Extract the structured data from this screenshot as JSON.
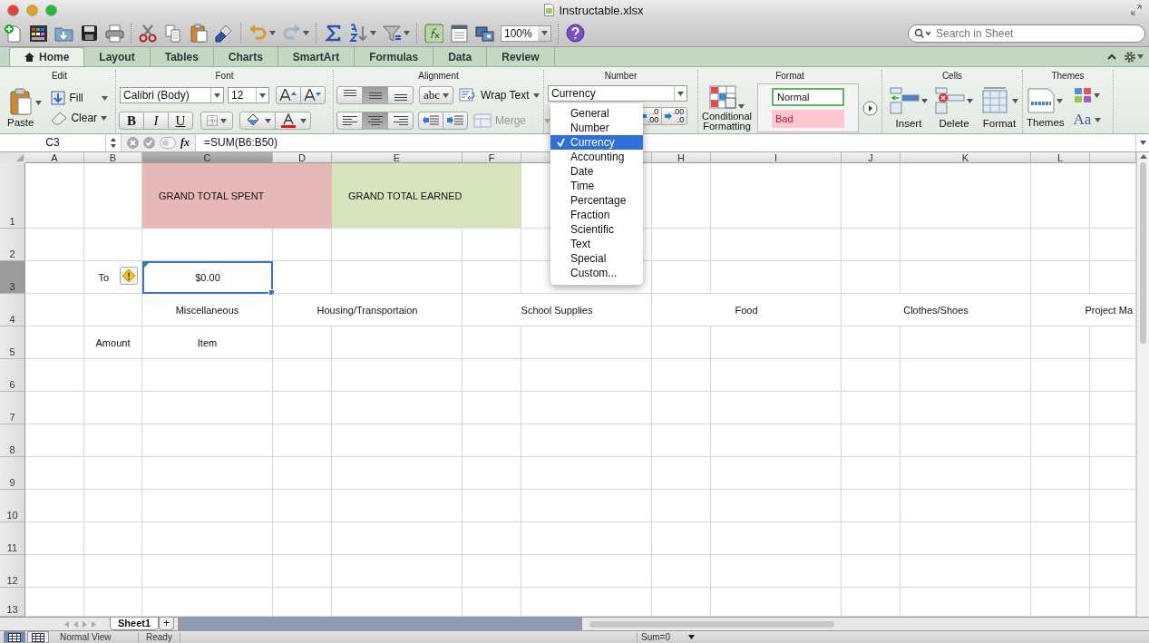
{
  "window": {
    "title": "Instructable.xlsx"
  },
  "toolbar": {
    "zoom": "100%",
    "search": {
      "placeholder": "Search in Sheet"
    }
  },
  "ribbon": {
    "tabs": [
      {
        "label": "Home",
        "selected": true
      },
      {
        "label": "Layout",
        "selected": false
      },
      {
        "label": "Tables",
        "selected": false
      },
      {
        "label": "Charts",
        "selected": false
      },
      {
        "label": "SmartArt",
        "selected": false
      },
      {
        "label": "Formulas",
        "selected": false
      },
      {
        "label": "Data",
        "selected": false
      },
      {
        "label": "Review",
        "selected": false
      }
    ],
    "edit": {
      "title": "Edit",
      "paste": "Paste",
      "fill": "Fill",
      "clear": "Clear"
    },
    "font": {
      "title": "Font",
      "font_name": "Calibri (Body)",
      "font_size": "12",
      "bold": "B",
      "italic": "I",
      "underline": "U"
    },
    "alignment": {
      "title": "Alignment",
      "vertical": [
        {
          "selected": false
        },
        {
          "selected": true
        },
        {
          "selected": false
        }
      ],
      "horizontal": [
        {
          "selected": false
        },
        {
          "selected": true
        },
        {
          "selected": false
        }
      ],
      "orientation": "abc",
      "wrap_text": "Wrap Text",
      "merge": {
        "label": "Merge",
        "disabled": true
      }
    },
    "number": {
      "title": "Number",
      "format": "Currency",
      "decimals": [
        {
          "top": ".0",
          "bottom": ".00"
        },
        {
          "top": ".00",
          "bottom": ".0"
        }
      ]
    },
    "format": {
      "title": "Format",
      "conditional": "Conditional Formatting",
      "styles": [
        {
          "label": "Normal",
          "color": "#ffffff"
        },
        {
          "label": "Bad",
          "color": "#ffc7ce"
        }
      ]
    },
    "cells": {
      "title": "Cells",
      "buttons": [
        "Insert",
        "Delete",
        "Format"
      ]
    },
    "themes": {
      "title": "Themes",
      "themes": "Themes",
      "fonts": "Aa"
    }
  },
  "formula_bar": {
    "name_box": "C3",
    "fx": "fx",
    "formula": "=SUM(B6:B50)"
  },
  "sheet": {
    "columns": [
      {
        "label": "A",
        "selected": false
      },
      {
        "label": "B",
        "selected": false
      },
      {
        "label": "C",
        "selected": true
      },
      {
        "label": "D",
        "selected": false
      },
      {
        "label": "E",
        "selected": false
      },
      {
        "label": "F",
        "selected": false
      },
      {
        "selected": false
      },
      {
        "label": "H",
        "selected": false
      },
      {
        "label": "I",
        "selected": false
      },
      {
        "label": "J",
        "selected": false
      },
      {
        "label": "K",
        "selected": false
      },
      {
        "label": "L",
        "selected": false
      },
      {
        "selected": false
      }
    ],
    "rows": [
      {
        "label": "1",
        "selected": false,
        "cells": [
          {},
          {},
          {
            "text": "GRAND TOTAL SPENT",
            "color": "#e6b8b7",
            "merged": true
          },
          {
            "text": "GRAND TOTAL EARNED",
            "color": "#d8e4bc",
            "merged": true
          }
        ]
      },
      {
        "label": "2",
        "selected": false
      },
      {
        "label": "3",
        "selected": true,
        "cells": [
          {},
          {
            "text": "To",
            "warning": true
          },
          {
            "text": "$0.00",
            "selected": true,
            "error_mark": true
          }
        ]
      },
      {
        "label": "4",
        "selected": false,
        "cells": [
          {},
          {},
          {
            "text": "Miscellaneous"
          },
          {
            "text": "Housing/Transportaion",
            "merged": true
          },
          {
            "text": "School Supplies",
            "merged": true
          },
          {
            "text": "Food",
            "merged": true
          },
          {
            "text": "Clothes/Shoes",
            "merged": true
          },
          {
            "text": "Project Ma",
            "merged": true
          }
        ]
      },
      {
        "label": "5",
        "selected": false,
        "cells": [
          {},
          {
            "text": "Amount"
          },
          {
            "text": "Item"
          }
        ]
      },
      {
        "label": "6",
        "selected": false
      },
      {
        "label": "7",
        "selected": false
      },
      {
        "label": "8",
        "selected": false
      },
      {
        "label": "9",
        "selected": false
      },
      {
        "label": "10",
        "selected": false
      },
      {
        "label": "11",
        "selected": false
      },
      {
        "label": "12",
        "selected": false
      },
      {
        "label": "13",
        "selected": false
      }
    ]
  },
  "number_format_menu": {
    "items": [
      {
        "label": "General",
        "selected": false
      },
      {
        "label": "Number",
        "selected": false
      },
      {
        "label": "Currency",
        "selected": true
      },
      {
        "label": "Accounting",
        "selected": false
      },
      {
        "label": "Date",
        "selected": false
      },
      {
        "label": "Time",
        "selected": false
      },
      {
        "label": "Percentage",
        "selected": false
      },
      {
        "label": "Fraction",
        "selected": false
      },
      {
        "label": "Scientific",
        "selected": false
      },
      {
        "label": "Text",
        "selected": false
      },
      {
        "label": "Special",
        "selected": false
      },
      {
        "label": "Custom...",
        "selected": false
      }
    ]
  },
  "sheet_tabs": {
    "tabs": [
      {
        "label": "Sheet1",
        "selected": true
      }
    ],
    "add": "+"
  },
  "status_bar": {
    "views": [
      {
        "selected": true
      },
      {
        "selected": false
      }
    ],
    "view": "Normal View",
    "state": "Ready",
    "sum": "Sum=0"
  }
}
